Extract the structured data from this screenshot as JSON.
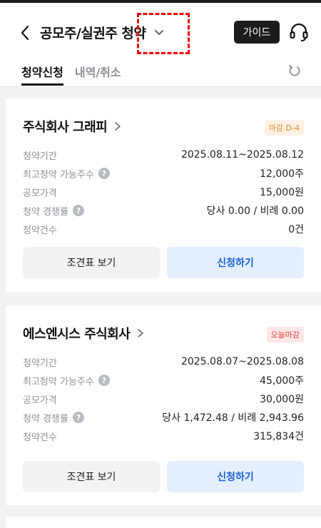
{
  "header": {
    "title": "공모주/실권주 청약",
    "guide_label": "가이드"
  },
  "tabs": [
    {
      "label": "청약신청",
      "active": true
    },
    {
      "label": "내역/취소",
      "active": false
    }
  ],
  "cards": [
    {
      "company": "주식회사 그래피",
      "badge": "마감 D-4",
      "badge_color": "#ea8a2e",
      "rows": [
        {
          "label": "청약기간",
          "value": "2025.08.11~2025.08.12",
          "help": false
        },
        {
          "label": "최고청약 가능주수",
          "value": "12,000주",
          "help": true
        },
        {
          "label": "공모가격",
          "value": "15,000원",
          "help": false
        },
        {
          "label": "청약 경쟁률",
          "value": "당사 0.00 / 비례 0.00",
          "help": true
        },
        {
          "label": "청약건수",
          "value": "0건",
          "help": false
        }
      ],
      "btn_terms": "조견표 보기",
      "btn_apply": "신청하기"
    },
    {
      "company": "에스엔시스 주식회사",
      "badge": "오늘마감",
      "badge_color": "#e03e3e",
      "rows": [
        {
          "label": "청약기간",
          "value": "2025.08.07~2025.08.08",
          "help": false
        },
        {
          "label": "최고청약 가능주수",
          "value": "45,000주",
          "help": true
        },
        {
          "label": "공모가격",
          "value": "30,000원",
          "help": false
        },
        {
          "label": "청약 경쟁률",
          "value": "당사 1,472.48 / 비례 2,943.96",
          "help": true
        },
        {
          "label": "청약건수",
          "value": "315,834건",
          "help": false
        }
      ],
      "btn_terms": "조견표 보기",
      "btn_apply": "신청하기"
    }
  ],
  "icons": {
    "back": "chevron-left-icon",
    "title_dropdown": "chevron-down-icon",
    "customer_service": "headset-icon",
    "refresh": "refresh-icon",
    "company_link": "chevron-right-icon",
    "help": "question-icon"
  },
  "help_glyph": "?"
}
